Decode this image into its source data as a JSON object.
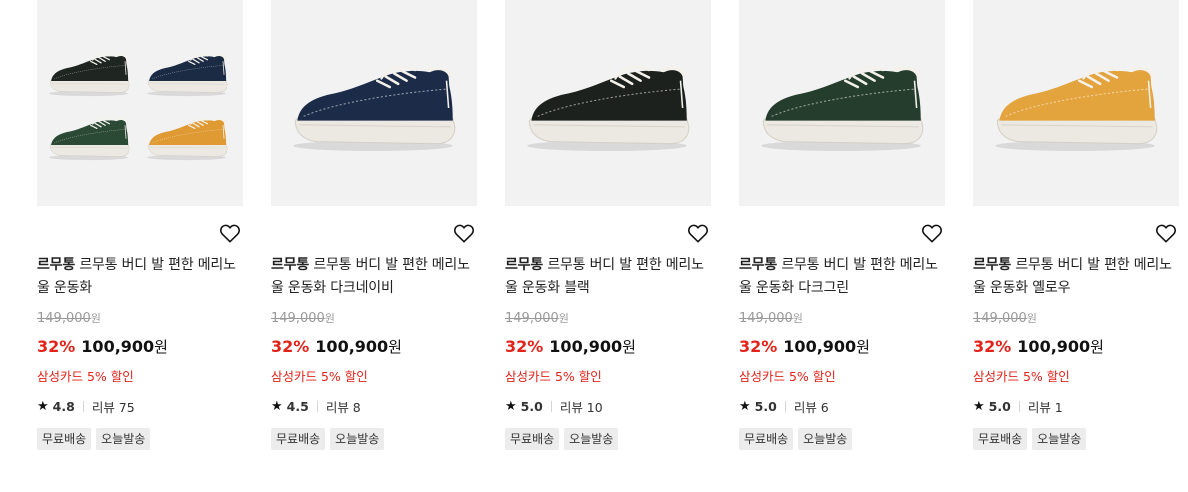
{
  "products": [
    {
      "brand": "르무통",
      "name": "르무통 버디 발 편한 메리노울 운동화",
      "original_price": "149,000",
      "original_unit": "원",
      "discount": "32%",
      "price": "100,900",
      "price_unit": "원",
      "card_promo": "삼성카드 5% 할인",
      "rating": "4.8",
      "review_label": "리뷰 75",
      "tags": [
        "무료배송",
        "오늘발송"
      ],
      "shoe_colors": [
        "#1f2622",
        "#1c2b44",
        "#2a4a35",
        "#e09a33"
      ]
    },
    {
      "brand": "르무통",
      "name": "르무통 버디 발 편한 메리노울 운동화 다크네이비",
      "original_price": "149,000",
      "original_unit": "원",
      "discount": "32%",
      "price": "100,900",
      "price_unit": "원",
      "card_promo": "삼성카드 5% 할인",
      "rating": "4.5",
      "review_label": "리뷰 8",
      "tags": [
        "무료배송",
        "오늘발송"
      ],
      "shoe_colors": [
        "#1c2b48"
      ]
    },
    {
      "brand": "르무통",
      "name": "르무통 버디 발 편한 메리노울 운동화 블랙",
      "original_price": "149,000",
      "original_unit": "원",
      "discount": "32%",
      "price": "100,900",
      "price_unit": "원",
      "card_promo": "삼성카드 5% 할인",
      "rating": "5.0",
      "review_label": "리뷰 10",
      "tags": [
        "무료배송",
        "오늘발송"
      ],
      "shoe_colors": [
        "#1d211e"
      ]
    },
    {
      "brand": "르무통",
      "name": "르무통 버디 발 편한 메리노울 운동화 다크그린",
      "original_price": "149,000",
      "original_unit": "원",
      "discount": "32%",
      "price": "100,900",
      "price_unit": "원",
      "card_promo": "삼성카드 5% 할인",
      "rating": "5.0",
      "review_label": "리뷰 6",
      "tags": [
        "무료배송",
        "오늘발송"
      ],
      "shoe_colors": [
        "#243d2d"
      ]
    },
    {
      "brand": "르무통",
      "name": "르무통 버디 발 편한 메리노울 운동화 옐로우",
      "original_price": "149,000",
      "original_unit": "원",
      "discount": "32%",
      "price": "100,900",
      "price_unit": "원",
      "card_promo": "삼성카드 5% 할인",
      "rating": "5.0",
      "review_label": "리뷰 1",
      "tags": [
        "무료배송",
        "오늘발송"
      ],
      "shoe_colors": [
        "#e3a33d"
      ]
    }
  ],
  "icons": {
    "wishlist": "heart-outline-icon",
    "rating": "star-icon"
  },
  "colors": {
    "discount": "#e2231a",
    "promo": "#e2231a",
    "thumb_bg": "#f2f2f2",
    "tag_bg": "#ececec"
  }
}
